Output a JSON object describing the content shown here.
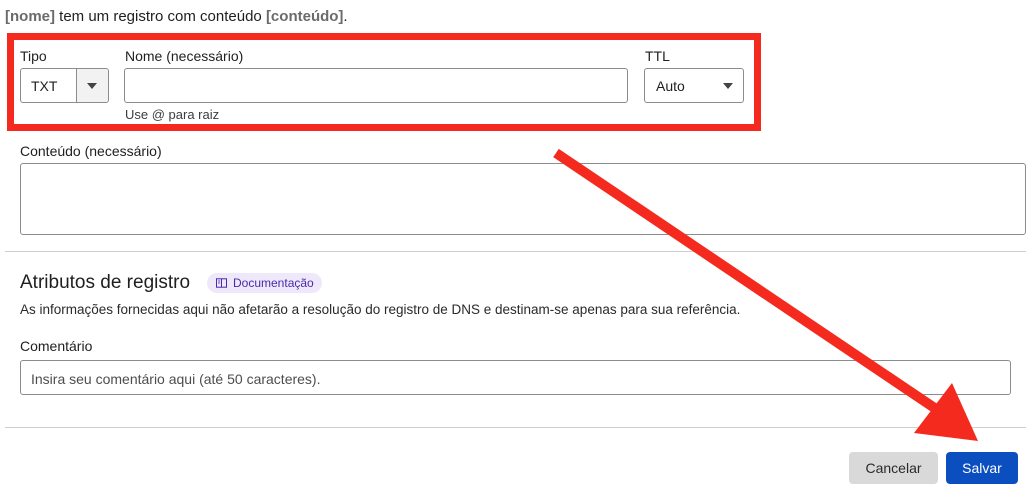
{
  "summary": {
    "name_token": "[nome]",
    "middle_text": " tem um registro com conteúdo ",
    "content_token": "[conteúdo]",
    "end_text": "."
  },
  "form": {
    "tipo_label": "Tipo",
    "tipo_value": "TXT",
    "nome_label": "Nome (necessário)",
    "nome_value": "",
    "nome_hint": "Use @ para raiz",
    "ttl_label": "TTL",
    "ttl_value": "Auto",
    "conteudo_label": "Conteúdo (necessário)",
    "conteudo_value": ""
  },
  "attributes": {
    "title": "Atributos de registro",
    "doc_link": "Documentação",
    "description": "As informações fornecidas aqui não afetarão a resolução do registro de DNS e destinam-se apenas para sua referência.",
    "comment_label": "Comentário",
    "comment_placeholder": "Insira seu comentário aqui (até 50 caracteres)."
  },
  "actions": {
    "cancel_label": "Cancelar",
    "save_label": "Salvar"
  },
  "colors": {
    "annotation_red": "#f42a1f",
    "save_blue": "#0a4ec0",
    "doc_pill_bg": "#efe8fb"
  }
}
